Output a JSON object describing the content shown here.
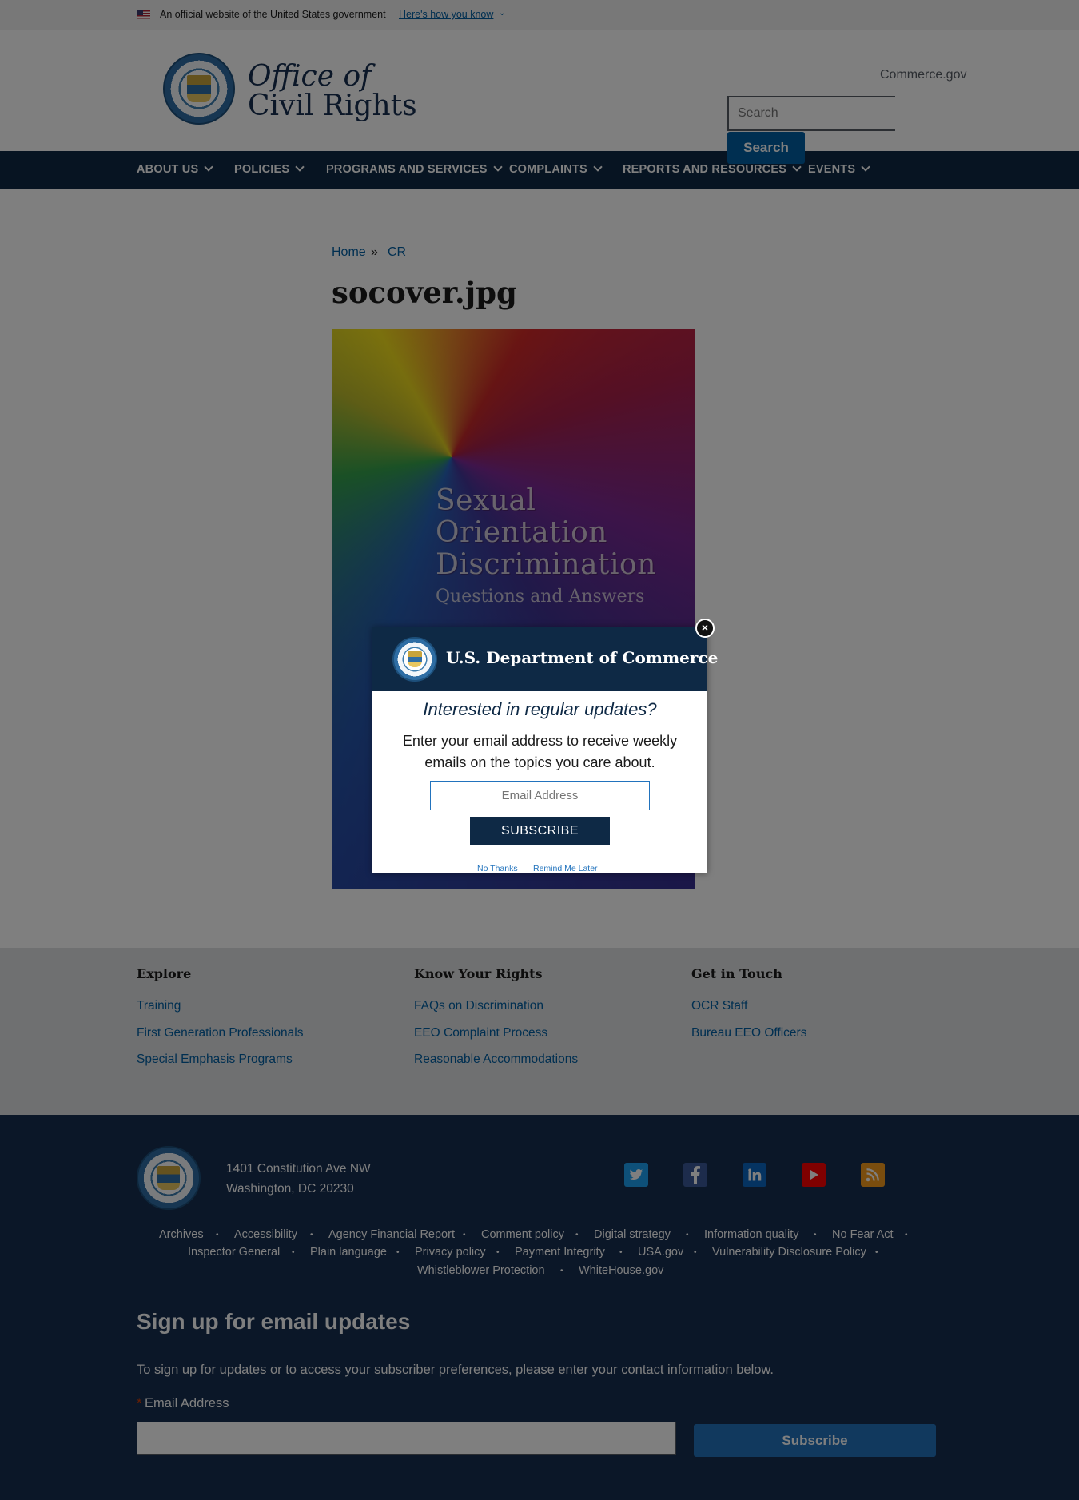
{
  "gov_banner": {
    "text": "An official website of the United States government",
    "link": "Here's how you know"
  },
  "header": {
    "title_line1": "Office of",
    "title_line2": "Civil Rights",
    "commerce_link": "Commerce.gov",
    "search_placeholder": "Search",
    "search_button": "Search"
  },
  "nav": {
    "items": [
      {
        "label": "ABOUT US"
      },
      {
        "label": "POLICIES"
      },
      {
        "label": "PROGRAMS AND SERVICES"
      },
      {
        "label": "COMPLAINTS"
      },
      {
        "label": "REPORTS AND RESOURCES"
      },
      {
        "label": "EVENTS"
      }
    ]
  },
  "breadcrumb": {
    "home": "Home",
    "separator": "»",
    "current": "CR"
  },
  "page": {
    "title": "socover.jpg",
    "cover_title_lines": [
      "Sexual",
      "Orientation",
      "Discrimination"
    ],
    "cover_subtitle": "Questions and Answers"
  },
  "footer_primary": {
    "columns": [
      {
        "heading": "Explore",
        "links": [
          "Training",
          "First Generation Professionals",
          "Special Emphasis Programs"
        ]
      },
      {
        "heading": "Know Your Rights",
        "links": [
          "FAQs on Discrimination",
          "EEO Complaint Process",
          "Reasonable Accommodations"
        ]
      },
      {
        "heading": "Get in Touch",
        "links": [
          "OCR Staff",
          "Bureau EEO Officers"
        ]
      }
    ]
  },
  "footer_secondary": {
    "address_line1": "1401 Constitution Ave NW",
    "address_line2": "Washington, DC 20230",
    "social": [
      {
        "icon": "twitter-icon",
        "color": "#1da1f2"
      },
      {
        "icon": "facebook-icon",
        "color": "#3b5998"
      },
      {
        "icon": "linkedin-icon",
        "color": "#0a66c2"
      },
      {
        "icon": "youtube-icon",
        "color": "#ff0000"
      },
      {
        "icon": "rss-icon",
        "color": "#f59a1d"
      }
    ],
    "links_row1": [
      "Archives",
      "Accessibility",
      "Agency Financial Report",
      "Comment policy",
      "Digital strategy",
      "Information quality",
      "No Fear Act"
    ],
    "links_row2": [
      "Inspector General",
      "Plain language",
      "Privacy policy",
      "Payment Integrity",
      "USA.gov",
      "Vulnerability Disclosure Policy"
    ],
    "links_row3": [
      "Whistleblower Protection",
      "WhiteHouse.gov"
    ]
  },
  "signup": {
    "heading": "Sign up for email updates",
    "text": "To sign up for updates or to access your subscriber preferences, please enter your contact information below.",
    "required_mark": "*",
    "email_label": "Email Address",
    "button": "Subscribe"
  },
  "modal": {
    "brand": "U.S. Department of Commerce",
    "heading": "Interested in regular updates?",
    "body": "Enter your email address to receive weekly emails on the topics you care about.",
    "email_placeholder": "Email Address",
    "subscribe": "SUBSCRIBE",
    "no_thanks": "No Thanks",
    "remind_later": "Remind Me Later",
    "close_glyph": "×"
  }
}
